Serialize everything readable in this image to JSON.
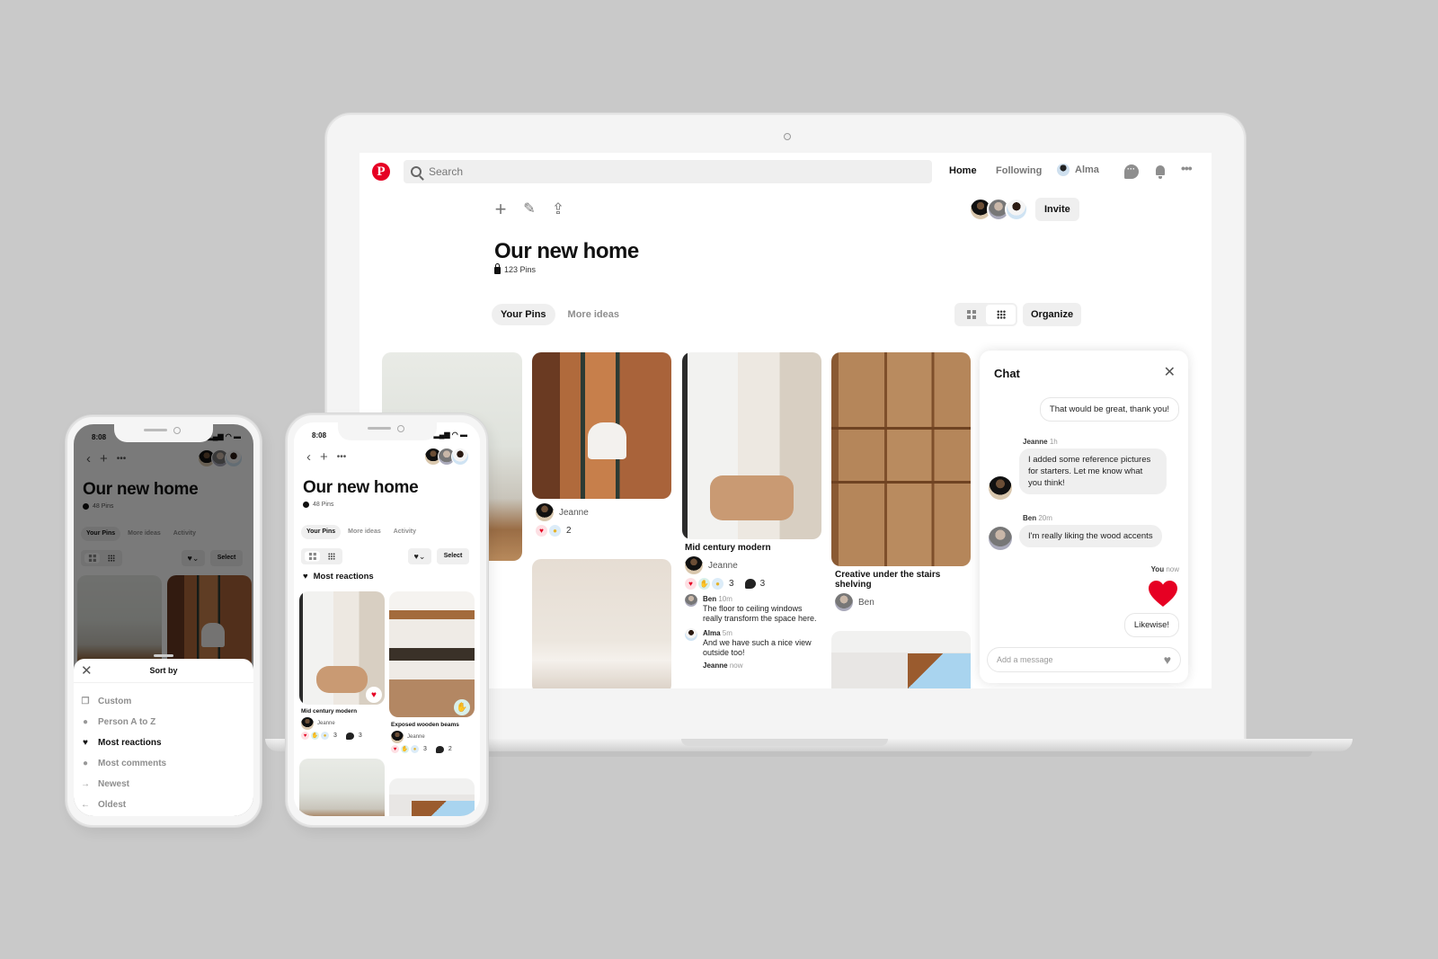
{
  "desktop": {
    "nav": {
      "logo": "P",
      "search_placeholder": "Search",
      "home": "Home",
      "following": "Following",
      "user": "Alma"
    },
    "board": {
      "title": "Our new home",
      "pin_count": "123 Pins",
      "invite": "Invite",
      "tabs": [
        {
          "label": "Your Pins",
          "active": true
        },
        {
          "label": "More ideas",
          "active": false
        }
      ],
      "organize": "Organize"
    },
    "pins": [
      {
        "user": "Jeanne",
        "reaction_count": "2"
      },
      {
        "title": "Mid century modern",
        "user": "Jeanne",
        "reaction_count": "3",
        "comment_count": "3",
        "comments": [
          {
            "name": "Ben",
            "time": "10m",
            "text": "The floor to ceiling windows really transform the space here."
          },
          {
            "name": "Alma",
            "time": "5m",
            "text": "And we have such a nice view outside too!"
          },
          {
            "name": "Jeanne",
            "time": "now",
            "text": ""
          }
        ]
      },
      {
        "title": "Creative under the stairs shelving",
        "user": "Ben"
      }
    ],
    "chat": {
      "title": "Chat",
      "messages": [
        {
          "from": "You",
          "text": "That would be great, thank you!"
        },
        {
          "from": "Jeanne",
          "time": "1h",
          "text": "I added some reference pictures for starters. Let me know what you think!"
        },
        {
          "from": "Ben",
          "time": "20m",
          "text": "I'm really liking the wood accents"
        },
        {
          "from": "You",
          "time": "now",
          "text": "Likewise!"
        }
      ],
      "input_placeholder": "Add a message"
    }
  },
  "phone_left": {
    "time": "8:08",
    "title": "Our new home",
    "pin_count": "48 Pins",
    "tabs": [
      "Your Pins",
      "More ideas",
      "Activity"
    ],
    "select": "Select",
    "sort_sheet": {
      "title": "Sort by",
      "options": [
        {
          "label": "Custom",
          "icon": "custom-icon",
          "selected": false
        },
        {
          "label": "Person A to Z",
          "icon": "person-icon",
          "selected": false
        },
        {
          "label": "Most reactions",
          "icon": "heart-icon",
          "selected": true
        },
        {
          "label": "Most comments",
          "icon": "comment-icon",
          "selected": false
        },
        {
          "label": "Newest",
          "icon": "arrow-right-icon",
          "selected": false
        },
        {
          "label": "Oldest",
          "icon": "arrow-left-icon",
          "selected": false
        }
      ]
    }
  },
  "phone_right": {
    "time": "8:08",
    "title": "Our new home",
    "pin_count": "48 Pins",
    "tabs": [
      "Your Pins",
      "More ideas",
      "Activity"
    ],
    "select": "Select",
    "section": "Most reactions",
    "pins": [
      {
        "title": "Mid century modern",
        "user": "Jeanne",
        "reaction_count": "3",
        "comment_count": "3"
      },
      {
        "title": "Exposed wooden beams",
        "user": "Jeanne",
        "reaction_count": "3",
        "comment_count": "2"
      }
    ]
  },
  "colors": {
    "brand": "#e60023",
    "background": "#c9c9c9"
  }
}
